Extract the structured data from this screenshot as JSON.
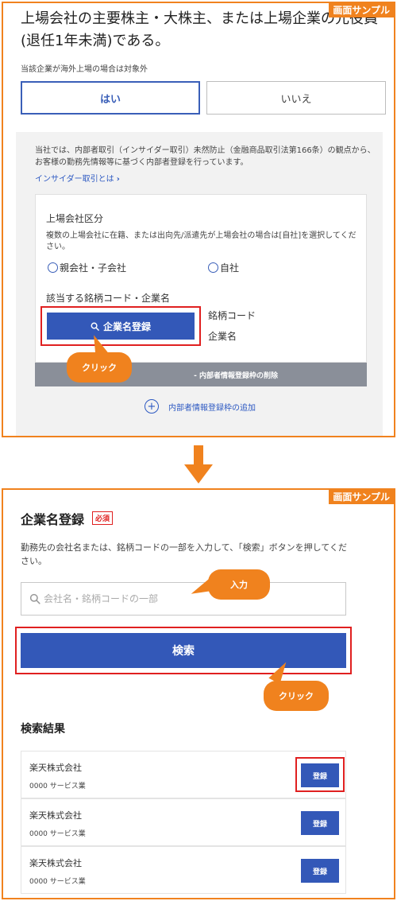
{
  "badge": "画面サンプル",
  "step1": {
    "question": "上場会社の主要株主・大株主、または上場企業の元役員(退任1年未満)である。",
    "note": "当該企業が海外上場の場合は対象外",
    "yes": "はい",
    "no": "いいえ",
    "description": "当社では、内部者取引（インサイダー取引）未然防止（金融商品取引法第166条）の観点から、お客様の勤務先情報等に基づく内部者登録を行っています。",
    "insider_link": "インサイダー取引とは",
    "company_type_label": "上場会社区分",
    "company_type_note": "複数の上場会社に在籍、または出向先/派遣先が上場会社の場合は[自社]を選択してください。",
    "radio_parent": "親会社・子会社",
    "radio_self": "自社",
    "stock_label": "該当する銘柄コード・企業名",
    "register_company_button": "企業名登録",
    "stock_code_label": "銘柄コード",
    "company_name_label": "企業名",
    "click_callout": "クリック",
    "delete_frame": "- 内部者情報登録枠の削除",
    "add_frame": "内部者情報登録枠の追加"
  },
  "step2": {
    "title": "企業名登録",
    "required": "必須",
    "description": "勤務先の会社名または、銘柄コードの一部を入力して、「検索」ボタンを押してください。",
    "search_placeholder": "会社名・銘柄コードの一部",
    "input_callout": "入力",
    "search_button": "検索",
    "click_callout": "クリック",
    "results_title": "検索結果",
    "results": [
      {
        "company": "楽天株式会社",
        "industry": "0000 サービス業",
        "button": "登録"
      },
      {
        "company": "楽天株式会社",
        "industry": "0000 サービス業",
        "button": "登録"
      },
      {
        "company": "楽天株式会社",
        "industry": "0000 サービス業",
        "button": "登録"
      }
    ]
  },
  "colors": {
    "accent_orange": "#f0821e",
    "primary_blue": "#3358b8",
    "highlight_red": "#e02020"
  }
}
